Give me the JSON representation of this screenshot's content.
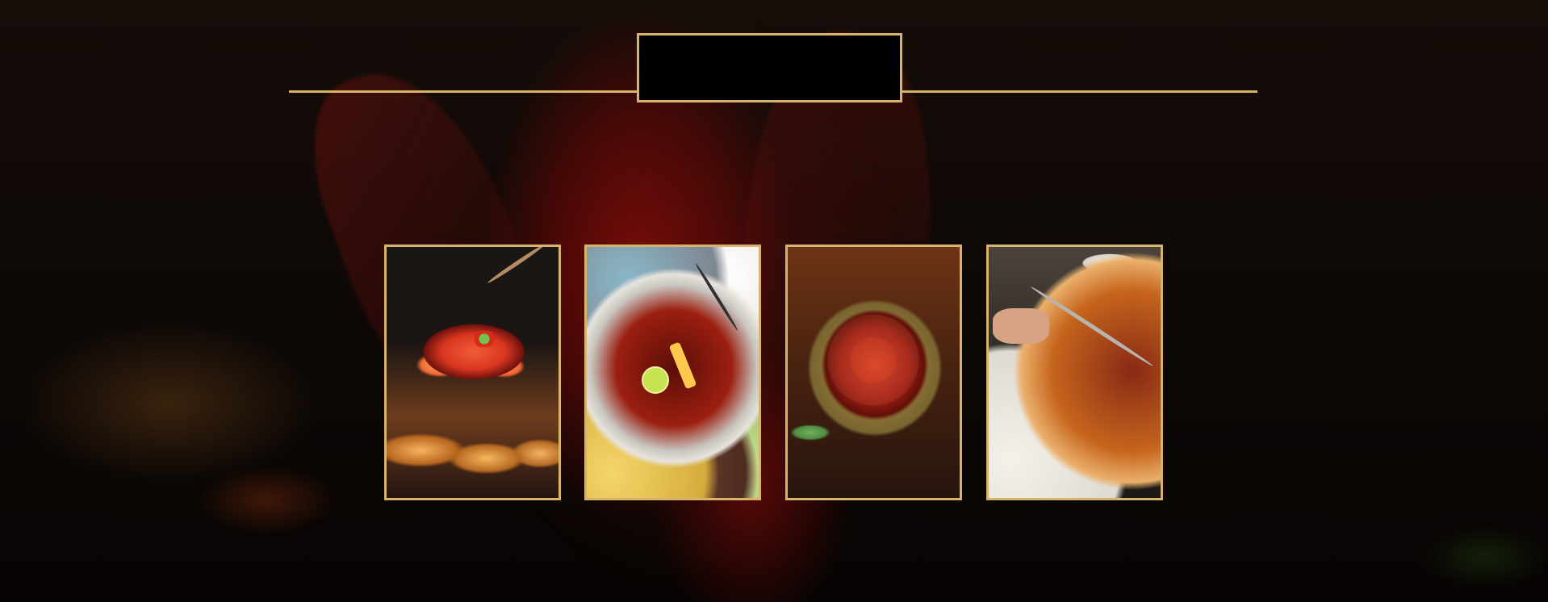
{
  "banner": {
    "title": "",
    "accent_color": "#d8b46a",
    "background_color": "#0c0705"
  },
  "gallery": {
    "items": [
      {
        "name": "spicy-shrimp-chicken-wings-photo",
        "caption": ""
      },
      {
        "name": "hotpot-photo",
        "caption": ""
      },
      {
        "name": "spicy-beef-platter-photo",
        "caption": ""
      },
      {
        "name": "copper-hotpot-photo",
        "caption": ""
      }
    ]
  }
}
